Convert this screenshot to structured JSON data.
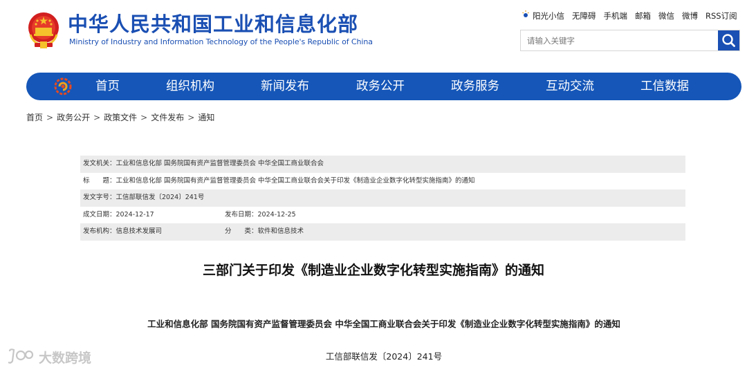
{
  "header": {
    "title": "中华人民共和国工业和信息化部",
    "subtitle": "Ministry of Industry and Information Technology of the People's Republic of China",
    "emblem_icon": "national-emblem-icon",
    "brand_color": "#1a4fb3"
  },
  "top_links": [
    {
      "label": "阳光小信",
      "icon": "sun-icon"
    },
    {
      "label": "无障碍"
    },
    {
      "label": "手机端"
    },
    {
      "label": "邮箱"
    },
    {
      "label": "微信"
    },
    {
      "label": "微博"
    },
    {
      "label": "RSS订阅"
    }
  ],
  "search": {
    "placeholder": "请输入关键字",
    "value": "",
    "icon": "search-icon"
  },
  "nav": {
    "color": "#1556b8",
    "logo_icon": "nav-logo-icon",
    "items": [
      "首页",
      "组织机构",
      "新闻发布",
      "政务公开",
      "政务服务",
      "互动交流",
      "工信数据"
    ]
  },
  "breadcrumb": [
    "首页",
    "政务公开",
    "政策文件",
    "文件发布",
    "通知"
  ],
  "info": {
    "issuer_label": "发文机关：",
    "issuer": "工业和信息化部 国务院国有资产监督管理委员会 中华全国工商业联合会",
    "title_label": "标　　题：",
    "title": "工业和信息化部 国务院国有资产监督管理委员会 中华全国工商业联合会关于印发《制造业企业数字化转型实施指南》的通知",
    "docno_label": "发文字号：",
    "docno": "工信部联信发〔2024〕241号",
    "created_label": "成文日期：",
    "created": "2024-12-17",
    "published_label": "发布日期：",
    "published": "2024-12-25",
    "org_label": "发布机构：",
    "org": "信息技术发展司",
    "category_label": "分　　类：",
    "category": "软件和信息技术"
  },
  "article": {
    "title": "三部门关于印发《制造业企业数字化转型实施指南》的通知",
    "subheading": "工业和信息化部 国务院国有资产监督管理委员会 中华全国工商业联合会关于印发《制造业企业数字化转型实施指南》的通知",
    "doc_number": "工信部联信发〔2024〕241号"
  },
  "watermark": {
    "text": "大数跨境",
    "icon": "chat-bubble-logo-icon"
  }
}
